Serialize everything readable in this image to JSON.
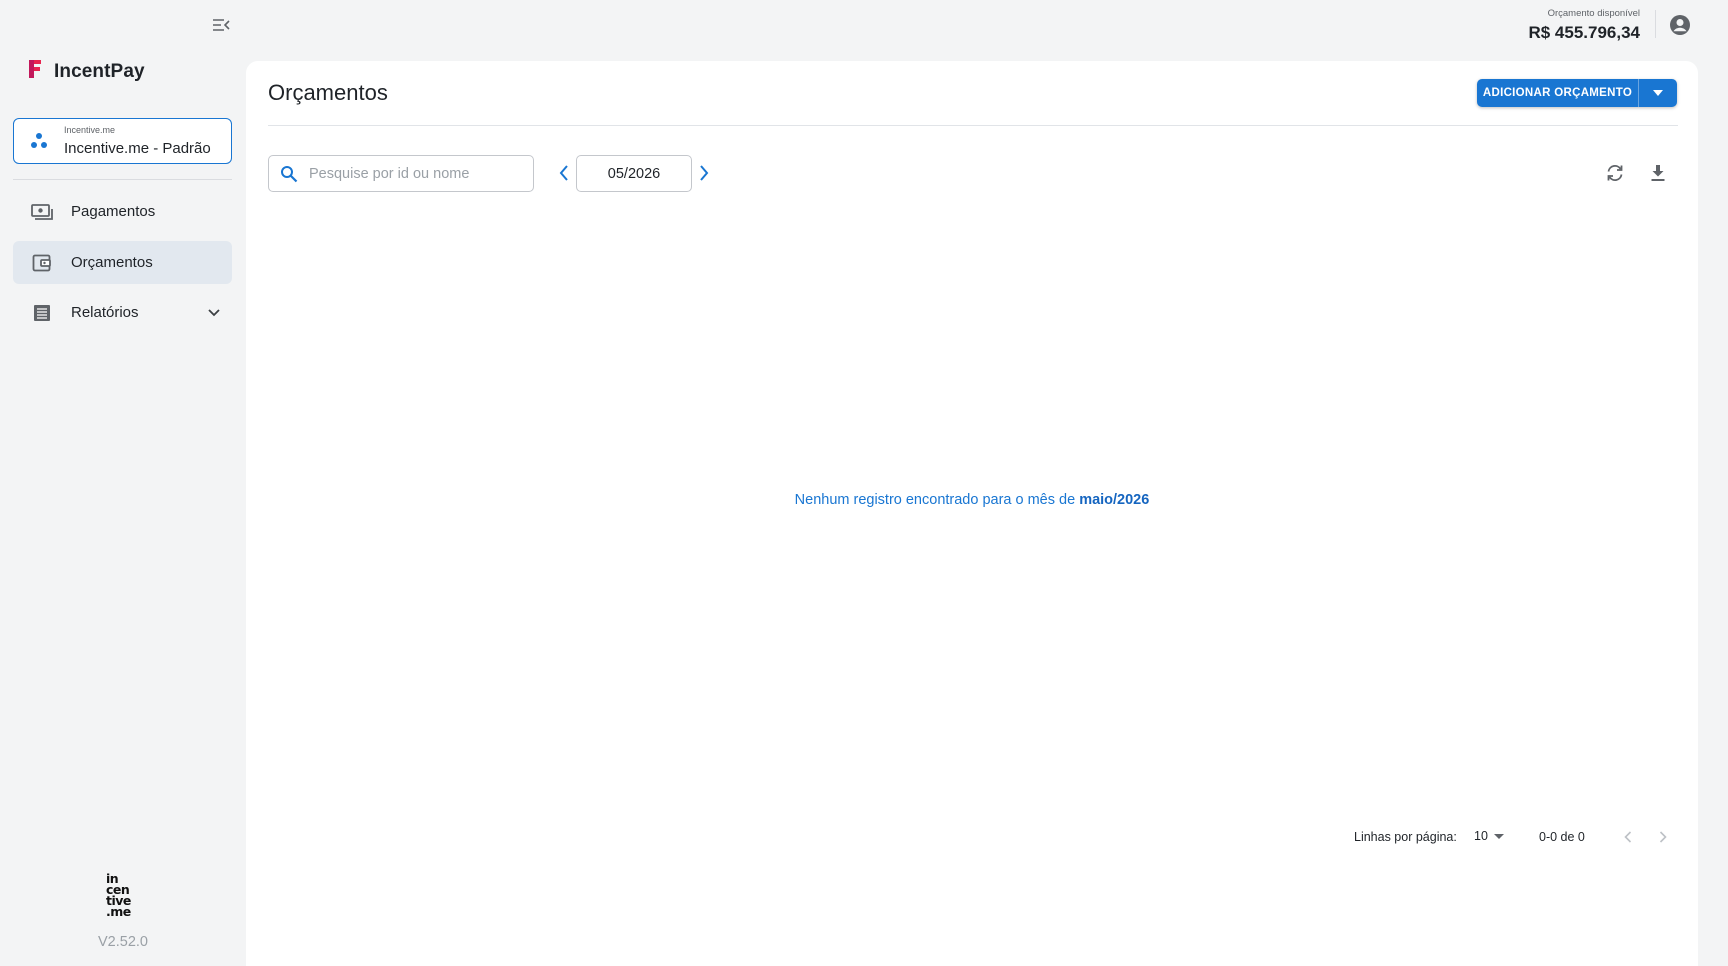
{
  "app": {
    "name": "IncentPay",
    "version": "V2.52.0",
    "footer_logo_lines": [
      "in",
      "cen",
      "tive",
      ".me"
    ]
  },
  "account": {
    "small_label": "Incentive.me",
    "name": "Incentive.me - Padrão"
  },
  "sidebar": {
    "items": [
      {
        "label": "Pagamentos",
        "icon": "payments-icon",
        "active": false
      },
      {
        "label": "Orçamentos",
        "icon": "wallet-icon",
        "active": true
      },
      {
        "label": "Relatórios",
        "icon": "report-icon",
        "active": false,
        "expandable": true
      }
    ]
  },
  "topbar": {
    "budget_label": "Orçamento disponível",
    "budget_value": "R$ 455.796,34"
  },
  "main": {
    "title": "Orçamentos",
    "add_button_label": "ADICIONAR ORÇAMENTO",
    "search_placeholder": "Pesquise por id ou nome",
    "month": "05/2026",
    "empty_prefix": "Nenhum registro encontrado para o mês de ",
    "empty_month": "maio/2026"
  },
  "pagination": {
    "rows_label": "Linhas por página:",
    "rows_value": "10",
    "range": "0-0 de 0"
  },
  "colors": {
    "primary": "#1976d2",
    "brand": "#e8254f",
    "background": "#f3f4f5"
  }
}
